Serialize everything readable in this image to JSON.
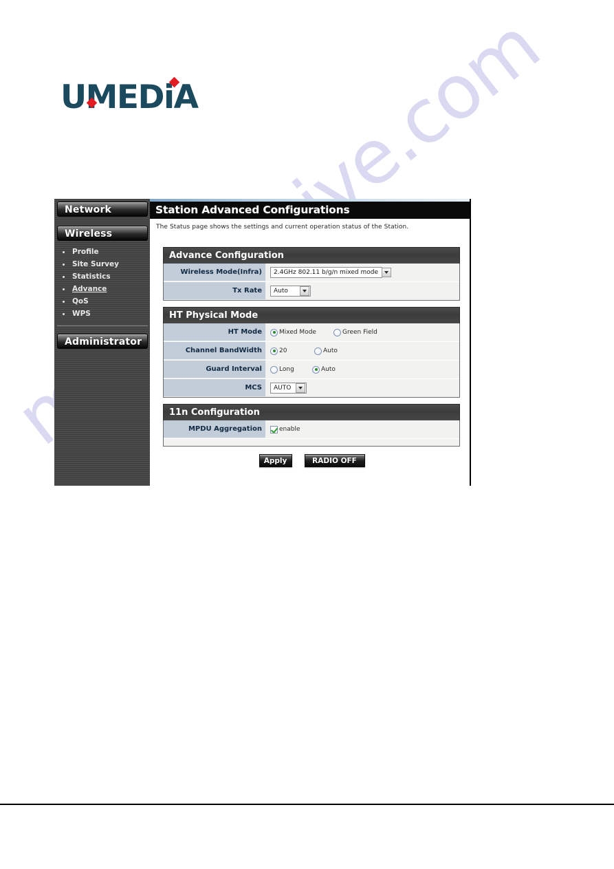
{
  "brand": {
    "logo_text": "UMEDiA",
    "logo_color": "#1b4a5e",
    "accent_color": "#e21b23"
  },
  "watermark": {
    "text": "manualshive.com",
    "color": "#d7d7f2"
  },
  "sidebar": {
    "groups": [
      {
        "label": "Network"
      },
      {
        "label": "Wireless"
      },
      {
        "label": "Administrator"
      }
    ],
    "wireless_items": [
      {
        "label": "Profile",
        "active": false
      },
      {
        "label": "Site Survey",
        "active": false
      },
      {
        "label": "Statistics",
        "active": false
      },
      {
        "label": "Advance",
        "active": true
      },
      {
        "label": "QoS",
        "active": false
      },
      {
        "label": "WPS",
        "active": false
      }
    ]
  },
  "content": {
    "page_title": "Station Advanced Configurations",
    "page_description": "The Status page shows the settings and current operation status of the Station.",
    "sections": {
      "advance": {
        "heading": "Advance Configuration",
        "wireless_mode_label": "Wireless Mode(Infra)",
        "wireless_mode_value": "2.4GHz 802.11 b/g/n mixed mode",
        "tx_rate_label": "Tx Rate",
        "tx_rate_value": "Auto"
      },
      "ht_physical": {
        "heading": "HT Physical Mode",
        "ht_mode_label": "HT Mode",
        "ht_mode_options": [
          {
            "label": "Mixed Mode",
            "selected": true
          },
          {
            "label": "Green Field",
            "selected": false
          }
        ],
        "channel_bandwidth_label": "Channel BandWidth",
        "channel_bandwidth_options": [
          {
            "label": "20",
            "selected": true
          },
          {
            "label": "Auto",
            "selected": false
          }
        ],
        "guard_interval_label": "Guard Interval",
        "guard_interval_options": [
          {
            "label": "Long",
            "selected": false
          },
          {
            "label": "Auto",
            "selected": true
          }
        ],
        "mcs_label": "MCS",
        "mcs_value": "AUTO"
      },
      "eleven_n": {
        "heading": "11n Configuration",
        "mpdu_label": "MPDU Aggregation",
        "mpdu_checkbox_label": "enable",
        "mpdu_checked": true
      }
    },
    "buttons": {
      "apply": "Apply",
      "radio_off": "RADIO OFF"
    }
  }
}
